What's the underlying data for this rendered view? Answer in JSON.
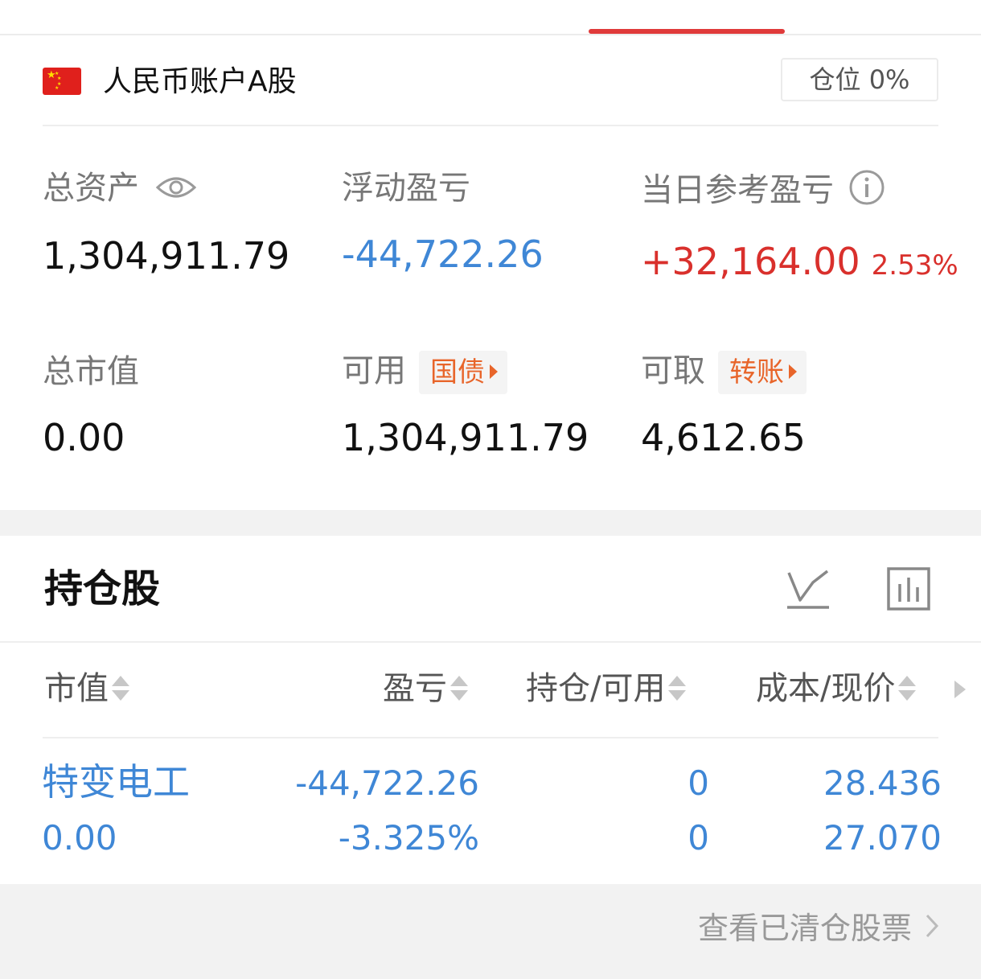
{
  "account": {
    "title": "人民币账户A股",
    "position_label": "仓位 0%"
  },
  "summary": {
    "total_assets": {
      "label": "总资产",
      "value": "1,304,911.79"
    },
    "floating_pnl": {
      "label": "浮动盈亏",
      "value": "-44,722.26"
    },
    "daily_pnl": {
      "label": "当日参考盈亏",
      "value": "+32,164.00",
      "percent": "2.53%"
    },
    "market_value": {
      "label": "总市值",
      "value": "0.00"
    },
    "available": {
      "label": "可用",
      "tag": "国债",
      "value": "1,304,911.79"
    },
    "withdrawable": {
      "label": "可取",
      "tag": "转账",
      "value": "4,612.65"
    }
  },
  "holdings": {
    "title": "持仓股",
    "columns": [
      "市值",
      "盈亏",
      "持仓/可用",
      "成本/现价"
    ],
    "rows": [
      {
        "name": "特变电工",
        "market_value": "0.00",
        "pnl": "-44,722.26",
        "pnl_pct": "-3.325%",
        "position": "0",
        "available": "0",
        "cost": "28.436",
        "price": "27.070"
      }
    ]
  },
  "footer": {
    "link": "查看已清仓股票"
  },
  "colors": {
    "accent": "#e03a3a",
    "up": "#d9302c",
    "down": "#3f87d6",
    "tag": "#e8652a"
  }
}
